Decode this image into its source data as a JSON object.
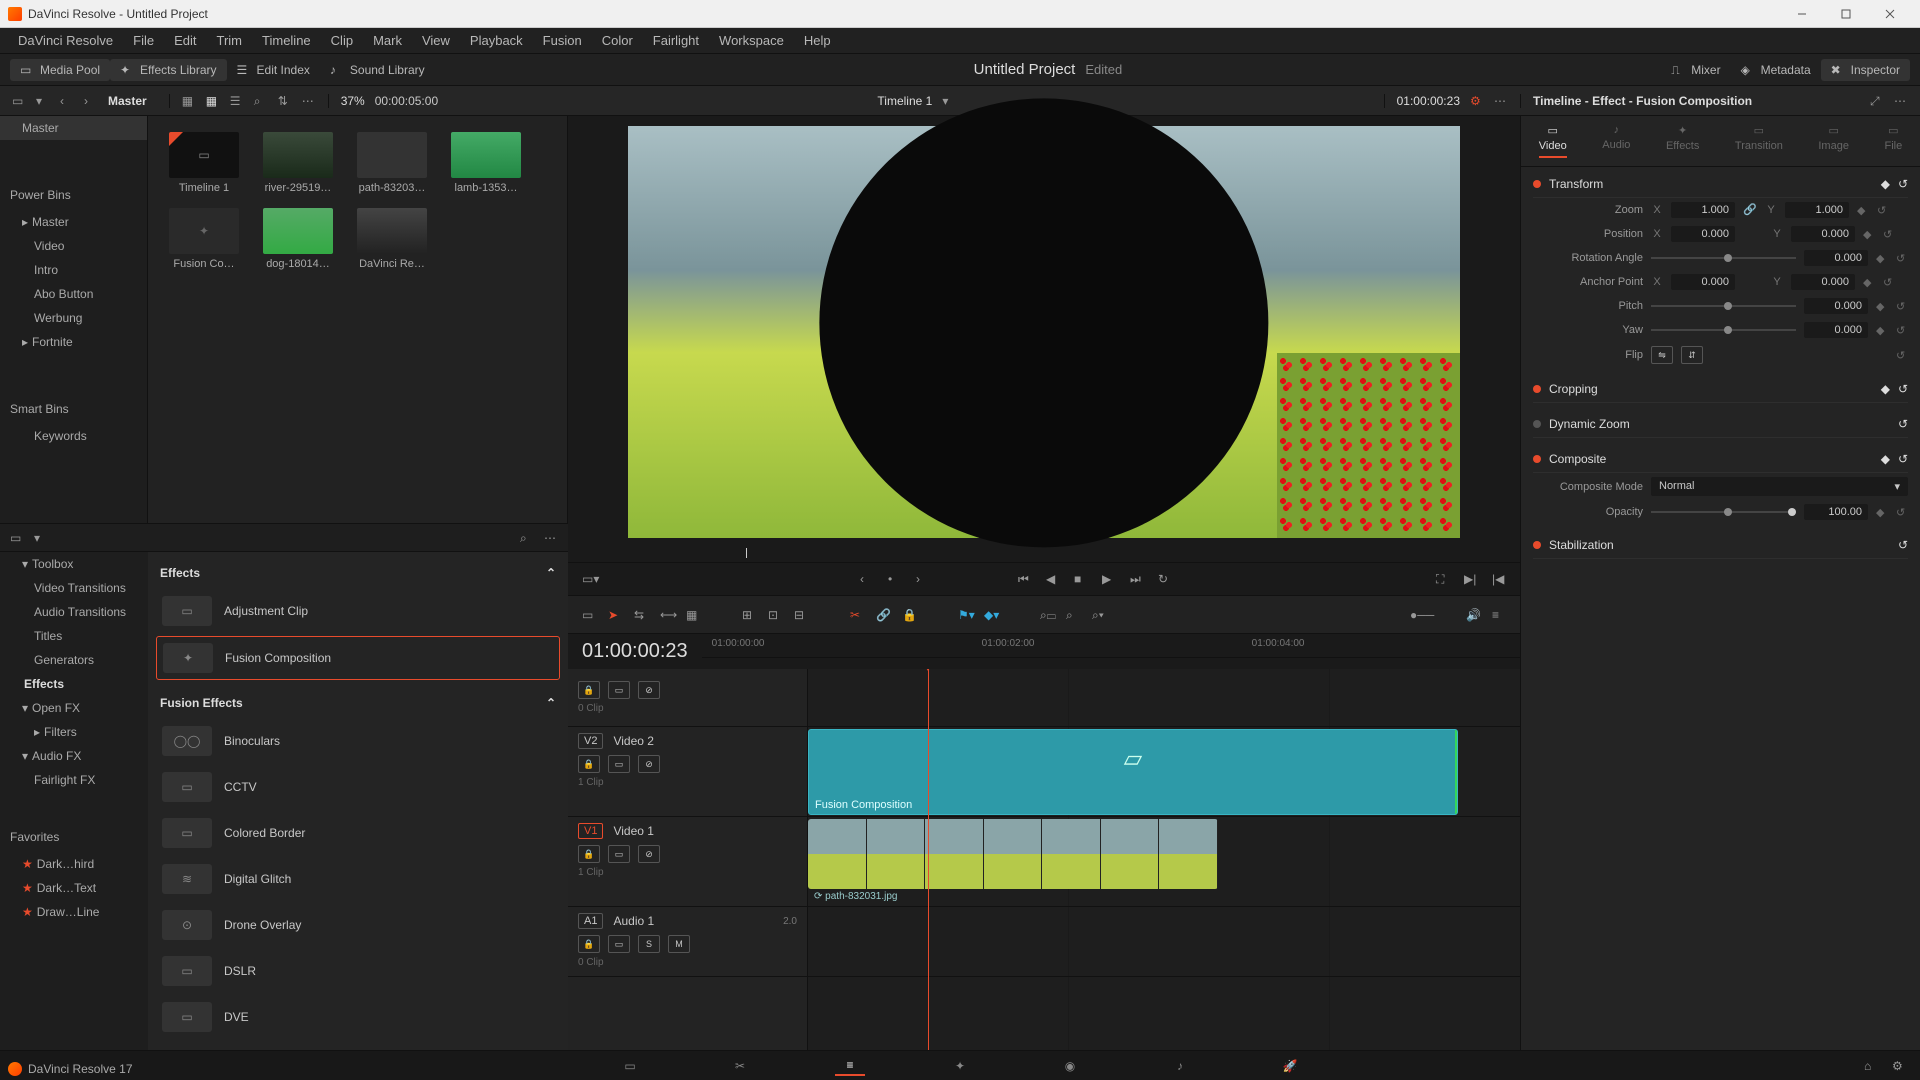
{
  "window": {
    "title": "DaVinci Resolve - Untitled Project"
  },
  "menus": [
    "DaVinci Resolve",
    "File",
    "Edit",
    "Trim",
    "Timeline",
    "Clip",
    "Mark",
    "View",
    "Playback",
    "Fusion",
    "Color",
    "Fairlight",
    "Workspace",
    "Help"
  ],
  "ws": {
    "media_pool": "Media Pool",
    "effects_library": "Effects Library",
    "edit_index": "Edit Index",
    "sound_library": "Sound Library",
    "mixer": "Mixer",
    "metadata": "Metadata",
    "inspector": "Inspector"
  },
  "project": {
    "name": "Untitled Project",
    "status": "Edited"
  },
  "strip": {
    "master": "Master",
    "zoom": "37%",
    "dur": "00:00:05:00",
    "timeline": "Timeline 1",
    "tc": "01:00:00:23",
    "insp_title": "Timeline - Effect - Fusion Composition"
  },
  "bins": {
    "master": "Master",
    "power": "Power Bins",
    "power_items": [
      "Master",
      "Video",
      "Intro",
      "Abo Button",
      "Werbung",
      "Fortnite"
    ],
    "smart": "Smart Bins",
    "smart_items": [
      "Keywords"
    ]
  },
  "clips": [
    {
      "name": "Timeline 1",
      "kind": "tl"
    },
    {
      "name": "river-29519…",
      "kind": "img"
    },
    {
      "name": "path-83203…",
      "kind": "field"
    },
    {
      "name": "lamb-1353…",
      "kind": "img"
    },
    {
      "name": "Fusion Co…",
      "kind": "blank"
    },
    {
      "name": "dog-18014…",
      "kind": "img"
    },
    {
      "name": "DaVinci Re…",
      "kind": "img"
    }
  ],
  "effnav": {
    "toolbox": "Toolbox",
    "toolbox_items": [
      "Video Transitions",
      "Audio Transitions",
      "Titles",
      "Generators",
      "Effects"
    ],
    "openfx": "Open FX",
    "openfx_items": [
      "Filters"
    ],
    "audiofx": "Audio FX",
    "audiofx_items": [
      "Fairlight FX"
    ],
    "fav": "Favorites",
    "fav_items": [
      "Dark…hird",
      "Dark…Text",
      "Draw…Line"
    ]
  },
  "effects": {
    "group1": "Effects",
    "items1": [
      "Adjustment Clip",
      "Fusion Composition"
    ],
    "group2": "Fusion Effects",
    "items2": [
      "Binoculars",
      "CCTV",
      "Colored Border",
      "Digital Glitch",
      "Drone Overlay",
      "DSLR",
      "DVE"
    ]
  },
  "timeline": {
    "tc": "01:00:00:23",
    "v2": "Video 2",
    "v1": "Video 1",
    "a1": "Audio 1",
    "v2tag": "V2",
    "v1tag": "V1",
    "a1tag": "A1",
    "v1info": "1 Clip",
    "v2info": "1 Clip",
    "v3info": "0 Clip",
    "a1info": "0 Clip",
    "a1ch": "2.0",
    "fusion_clip": "Fusion Composition",
    "video_clip": "path-832031.jpg",
    "ruler": [
      "01:00:00:00",
      "01:00:02:00",
      "01:00:04:00"
    ]
  },
  "inspector": {
    "tabs": [
      "Video",
      "Audio",
      "Effects",
      "Transition",
      "Image",
      "File"
    ],
    "transform": "Transform",
    "cropping": "Cropping",
    "dynzoom": "Dynamic Zoom",
    "composite": "Composite",
    "stabilization": "Stabilization",
    "zoom": "Zoom",
    "position": "Position",
    "rotation": "Rotation Angle",
    "anchor": "Anchor Point",
    "pitch": "Pitch",
    "yaw": "Yaw",
    "flip": "Flip",
    "compmode_lbl": "Composite Mode",
    "compmode": "Normal",
    "opacity_lbl": "Opacity",
    "opacity": "100.00",
    "vals": {
      "zoom_x": "1.000",
      "zoom_y": "1.000",
      "pos_x": "0.000",
      "pos_y": "0.000",
      "rot": "0.000",
      "anc_x": "0.000",
      "anc_y": "0.000",
      "pitch": "0.000",
      "yaw": "0.000"
    }
  },
  "status": "DaVinci Resolve 17"
}
